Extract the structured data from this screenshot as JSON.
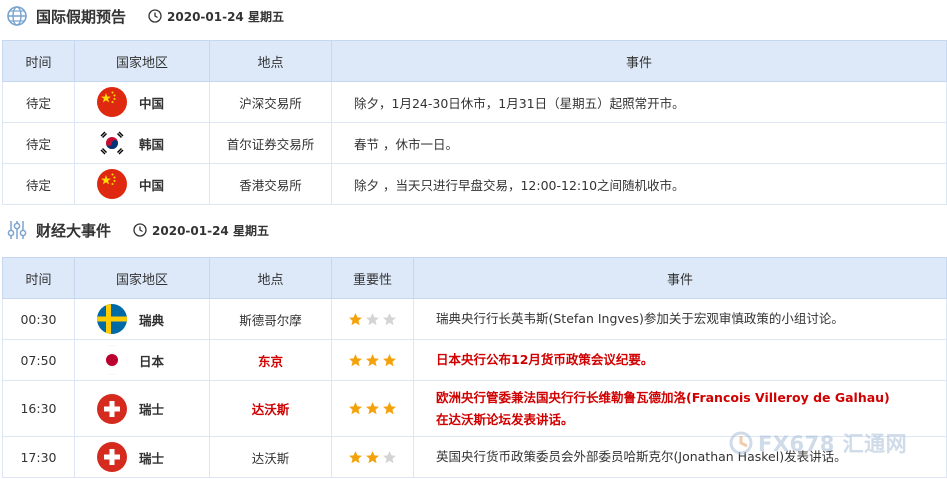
{
  "holiday": {
    "title": "国际假期预告",
    "date": "2020-01-24 星期五",
    "headers": [
      "时间",
      "国家地区",
      "地点",
      "事件"
    ],
    "rows": [
      {
        "time": "待定",
        "country": "中国",
        "flag": "cn",
        "place": "沪深交易所",
        "event": "除夕，1月24-30日休市，1月31日（星期五）起照常开市。"
      },
      {
        "time": "待定",
        "country": "韩国",
        "flag": "kr",
        "place": "首尔证券交易所",
        "event": "春节 ，休市一日。"
      },
      {
        "time": "待定",
        "country": "中国",
        "flag": "cn",
        "place": "香港交易所",
        "event": "除夕 ，当天只进行早盘交易，12:00-12:10之间随机收市。"
      }
    ]
  },
  "events": {
    "title": "财经大事件",
    "date": "2020-01-24 星期五",
    "headers": [
      "时间",
      "国家地区",
      "地点",
      "重要性",
      "事件"
    ],
    "rows": [
      {
        "time": "00:30",
        "country": "瑞典",
        "flag": "se",
        "place": "斯德哥尔摩",
        "importance": 1,
        "highlight": false,
        "event": "瑞典央行行长英韦斯(Stefan Ingves)参加关于宏观审慎政策的小组讨论。",
        "event_line2": ""
      },
      {
        "time": "07:50",
        "country": "日本",
        "flag": "jp",
        "place": "东京",
        "importance": 3,
        "highlight": true,
        "event": "日本央行公布12月货币政策会议纪要。",
        "event_line2": ""
      },
      {
        "time": "16:30",
        "country": "瑞士",
        "flag": "ch",
        "place": "达沃斯",
        "importance": 3,
        "highlight": true,
        "event": "欧洲央行管委兼法国央行行长维勒鲁瓦德加洛(Francois Villeroy de Galhau)",
        "event_line2": "在达沃斯论坛发表讲话。"
      },
      {
        "time": "17:30",
        "country": "瑞士",
        "flag": "ch",
        "place": "达沃斯",
        "importance": 2,
        "highlight": false,
        "event": "英国央行货币政策委员会外部委员哈斯克尔(Jonathan Haskel)发表讲话。",
        "event_line2": ""
      }
    ]
  },
  "watermark": {
    "text": "FX678 汇通网"
  },
  "colors": {
    "header_bg": "#dde9f9",
    "highlight": "#d00000",
    "star_on": "#f4a20c",
    "star_off": "#d4d4d4"
  }
}
